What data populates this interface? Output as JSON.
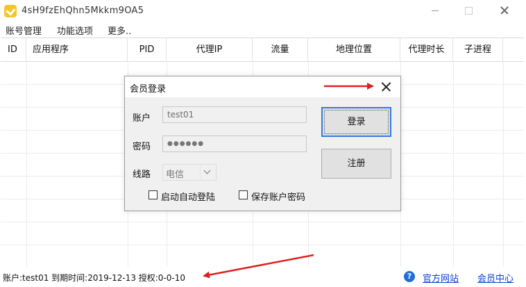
{
  "window": {
    "title": "4sH9fzEhQhn5Mkkm9OA5",
    "icon": "check-badge-icon",
    "accent": "#f6c52b"
  },
  "menu": {
    "items": [
      "账号管理",
      "功能选项",
      "更多.."
    ]
  },
  "table": {
    "columns": [
      "ID",
      "应用程序",
      "PID",
      "代理IP",
      "流量",
      "地理位置",
      "代理时长",
      "子进程"
    ]
  },
  "dialog": {
    "title": "会员登录",
    "account_label": "账户",
    "account_value": "test01",
    "password_label": "密码",
    "password_value": "●●●●●●",
    "line_label": "线路",
    "line_value": "电信",
    "login_button": "登录",
    "register_button": "注册",
    "auto_login_label": "启动自动登陆",
    "auto_login_checked": false,
    "save_password_label": "保存账户密码",
    "save_password_checked": false
  },
  "status": {
    "text": "账户:test01  到期时间:2019-12-13  授权:0-0-10",
    "official_site": "官方网站",
    "member_center": "会员中心",
    "help_icon": "help-icon",
    "link_color": "#0a3fd0"
  },
  "annotations": {
    "arrow_color": "#e02020"
  }
}
